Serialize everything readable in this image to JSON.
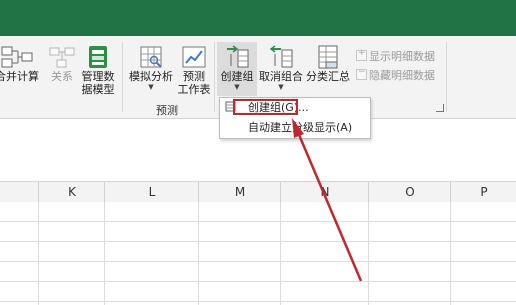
{
  "ribbon": {
    "buttons": {
      "consolidate": "合并计算",
      "relationships": "关系",
      "data_model": [
        "管理数",
        "据模型"
      ],
      "what_if": "模拟分析",
      "forecast": [
        "预测",
        "工作表"
      ],
      "group": "创建组",
      "ungroup": "取消组合",
      "subtotal": "分类汇总"
    },
    "small_buttons": {
      "show_detail": "显示明细数据",
      "hide_detail": "隐藏明细数据"
    },
    "groups": {
      "forecast": "预测"
    }
  },
  "dropdown": {
    "items": [
      "创建组(G)...",
      "自动建立分级显示(A)"
    ],
    "highlighted_index": 0
  },
  "columns": [
    "K",
    "L",
    "M",
    "N",
    "O",
    "P"
  ],
  "colors": {
    "title_bar": "#217346",
    "annotation": "#c0282d"
  }
}
